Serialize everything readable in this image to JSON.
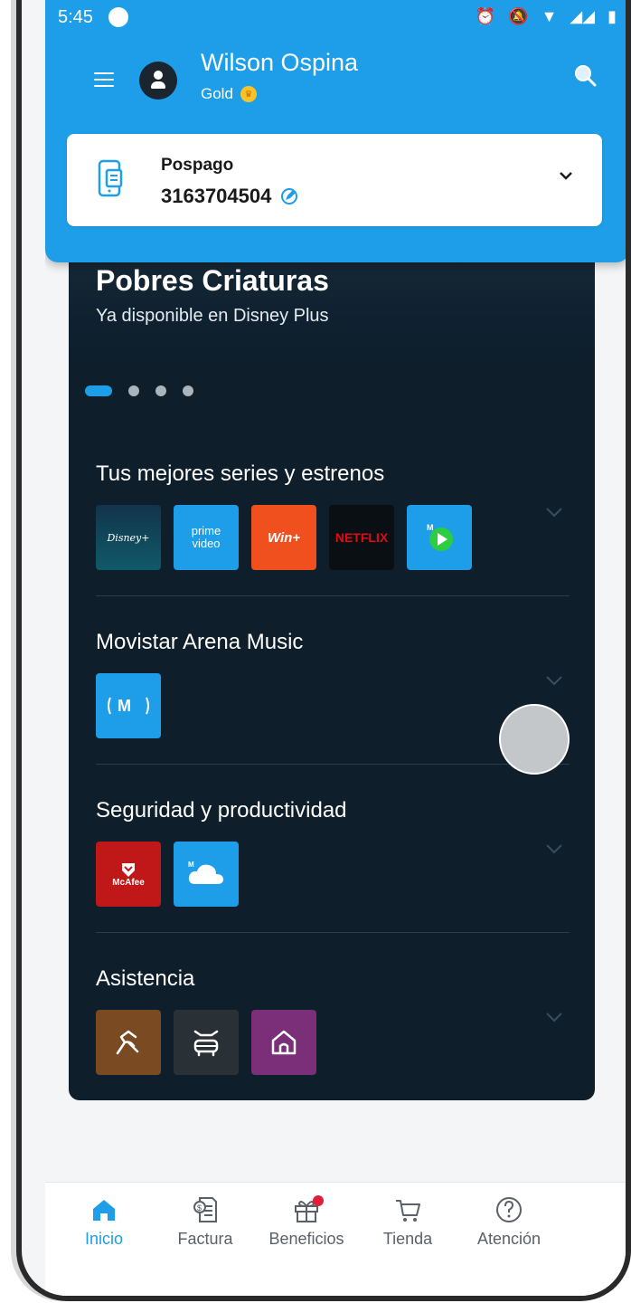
{
  "status_bar": {
    "time": "5:45",
    "icons": [
      "alarm-icon",
      "mute-icon",
      "wifi-icon",
      "signal-icon",
      "battery-icon"
    ]
  },
  "header": {
    "user_name": "Wilson Ospina",
    "tier": "Gold"
  },
  "line_card": {
    "type": "Pospago",
    "number": "3163704504"
  },
  "banner": {
    "title": "Pobres Criaturas",
    "subtitle": "Ya disponible en Disney Plus",
    "pages": 4,
    "active_page": 1
  },
  "sections": [
    {
      "title": "Tus mejores series y estrenos",
      "tiles": [
        "Disney+",
        "prime video",
        "Win+",
        "NETFLIX",
        "Movistar Play"
      ]
    },
    {
      "title": "Movistar Arena Music",
      "tiles": [
        "Movistar Music"
      ]
    },
    {
      "title": "Seguridad y productividad",
      "tiles": [
        "McAfee",
        "Movistar Cloud"
      ]
    },
    {
      "title": "Asistencia",
      "tiles": [
        "pet-assist-icon",
        "car-assist-icon",
        "home-assist-icon"
      ]
    }
  ],
  "bottom_nav": [
    {
      "label": "Inicio",
      "active": true
    },
    {
      "label": "Factura",
      "active": false
    },
    {
      "label": "Beneficios",
      "active": false,
      "badge": true
    },
    {
      "label": "Tienda",
      "active": false
    },
    {
      "label": "Atención",
      "active": false
    }
  ],
  "colors": {
    "primary": "#1e9ee8",
    "panel": "#0e1e2b",
    "gold": "#f7c325"
  }
}
